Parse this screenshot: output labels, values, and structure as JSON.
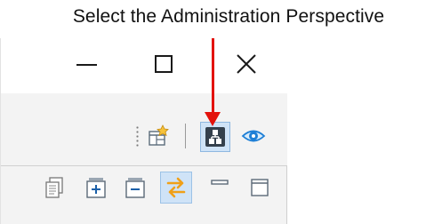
{
  "callout": {
    "text": "Select the Administration Perspective",
    "arrow_color": "#e3120b"
  },
  "window_controls": {
    "minimize_icon": "minimize-icon",
    "maximize_icon": "maximize-icon",
    "close_icon": "close-icon"
  },
  "perspective_toolbar": {
    "items": [
      {
        "name": "open-perspective-button",
        "icon": "open-perspective-icon"
      },
      {
        "name": "administration-perspective-button",
        "icon": "administration-perspective-icon",
        "selected": true
      },
      {
        "name": "watch-perspective-button",
        "icon": "eye-icon"
      }
    ]
  },
  "view_toolbar": {
    "items": [
      {
        "name": "copy-button",
        "icon": "copy-icon"
      },
      {
        "name": "expand-all-button",
        "icon": "expand-all-icon"
      },
      {
        "name": "collapse-all-button",
        "icon": "collapse-all-icon"
      },
      {
        "name": "link-with-editor-button",
        "icon": "link-with-editor-icon",
        "selected": true
      },
      {
        "name": "minimize-view-button",
        "icon": "minimize-view-icon"
      },
      {
        "name": "maximize-view-button",
        "icon": "maximize-view-icon"
      }
    ]
  },
  "colors": {
    "selected_background": "#cfe3f7",
    "accent_blue": "#1e7fd6",
    "link_orange": "#f0a018"
  }
}
